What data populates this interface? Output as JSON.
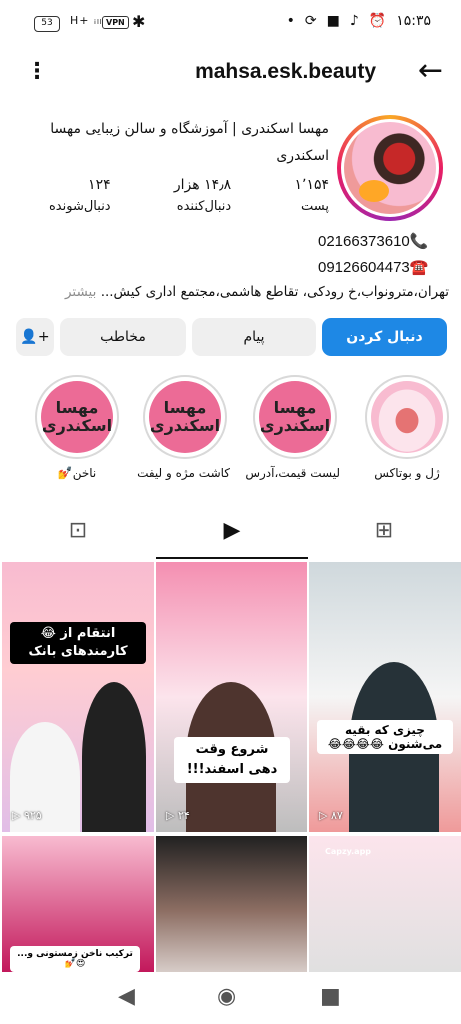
{
  "status_bar": {
    "battery": "53",
    "signal": "H+ ᵢₗₗ",
    "vpn": "VPN",
    "time": "۱۵:۳۵",
    "icons": [
      "bluetooth-icon",
      "dot-icon",
      "sync-icon",
      "square-icon",
      "tiktok-icon",
      "alarm-icon"
    ]
  },
  "header": {
    "username": "mahsa.esk.beauty"
  },
  "profile": {
    "full_name": "مهسا اسکندری | آموزشگاه و سالن زیبایی مهسا اسکندری",
    "posts_count": "۱٬۱۵۴",
    "posts_label": "پست",
    "followers_count": "۱۴٫۸ هزار",
    "followers_label": "دنبال‌کننده",
    "following_count": "۱۲۴",
    "following_label": "دنبال‌شونده",
    "phone1": "02166373610📞",
    "phone2": "09126604473☎️",
    "address": "تهران،مترونواب،خ رودکی، تقاطع هاشمی،مجتمع اداری کیش...",
    "more_label": "بیشتر"
  },
  "buttons": {
    "follow": "دنبال کردن",
    "message": "پیام",
    "contact": "مخاطب"
  },
  "highlights": [
    {
      "label": "ژل و بوتاکس",
      "logo": ""
    },
    {
      "label": "لیست قیمت،آدرس",
      "logo": "مهسا اسکندری"
    },
    {
      "label": "کاشت مژه و لیفت",
      "logo": "مهسا اسکندری"
    },
    {
      "label": "ناخن💅",
      "logo": "مهسا اسکندری"
    }
  ],
  "grid": {
    "cap1": "انتقام از 😂 کارمندهای بانک",
    "views1": "۹۲۵",
    "cap2": "شروع وقت دهی اسفند!!!",
    "views2": "۲۴",
    "cap3": "چیزی که بقیه می‌شنون 😂😂😂😂",
    "views3": "۸۷",
    "cap4": "ترکیب ناخن زمستونی و... 😍💅",
    "cap6": "Capzy.app"
  }
}
